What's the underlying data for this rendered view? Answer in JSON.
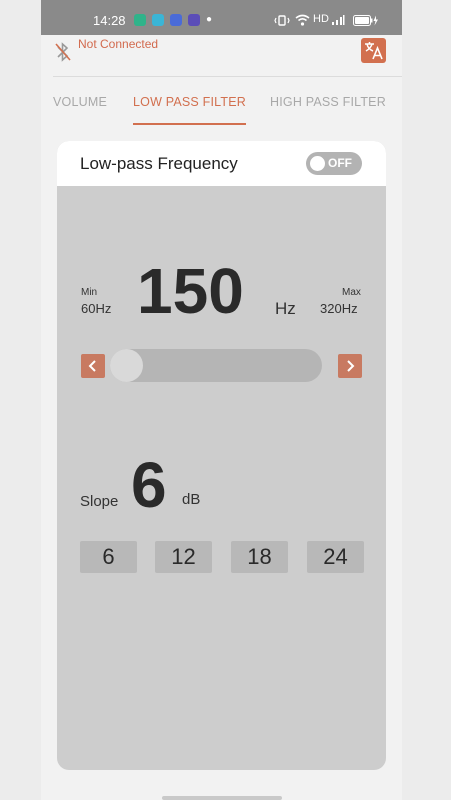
{
  "status_bar": {
    "time": "14:28",
    "network": "HD",
    "apps": [
      "#2fb38a",
      "#3ab5d6",
      "#4a6bd8",
      "#5b4db8"
    ]
  },
  "header": {
    "connection_status": "Not Connected",
    "translate_icon": "translate-icon"
  },
  "tabs": [
    {
      "label": "VOLUME",
      "active": false
    },
    {
      "label": "LOW PASS FILTER",
      "active": true
    },
    {
      "label": "HIGH PASS FILTER",
      "active": false
    }
  ],
  "card": {
    "title": "Low-pass Frequency",
    "toggle_label": "OFF",
    "toggle_on": false
  },
  "frequency": {
    "min_label": "Min",
    "min_value": "60Hz",
    "max_label": "Max",
    "max_value": "320Hz",
    "value": "150",
    "unit": "Hz",
    "slider_fraction": 0.0
  },
  "slope": {
    "label": "Slope",
    "value": "6",
    "unit": "dB",
    "options": [
      "6",
      "12",
      "18",
      "24"
    ]
  },
  "colors": {
    "accent": "#d2704f",
    "arrow": "#c87a61"
  }
}
